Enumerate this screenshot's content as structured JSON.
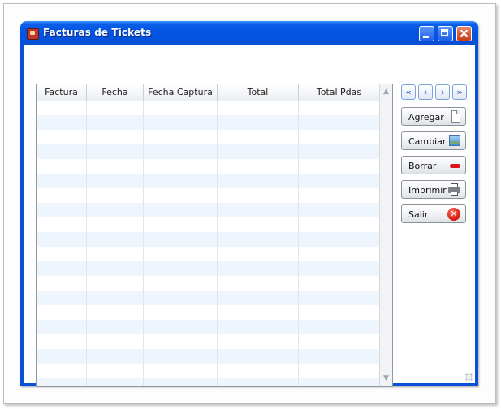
{
  "window": {
    "title": "Facturas de Tickets"
  },
  "table": {
    "columns": [
      "Factura",
      "Fecha",
      "Fecha Captura",
      "Total",
      "Total Pdas"
    ]
  },
  "navigation": {
    "first_label": "«",
    "prev_label": "‹",
    "next_label": "›",
    "last_label": "»"
  },
  "actions": {
    "agregar": "Agregar",
    "cambiar": "Cambiar",
    "borrar": "Borrar",
    "imprimir": "Imprimir",
    "salir": "Salir"
  },
  "scrollbar": {
    "up_arrow": "▲",
    "down_arrow": "▼"
  },
  "colors": {
    "title_bar": "#0553e3",
    "row_alt": "#eef5fc",
    "nav_accent": "#3b6bc4",
    "close_red": "#d8170c"
  }
}
